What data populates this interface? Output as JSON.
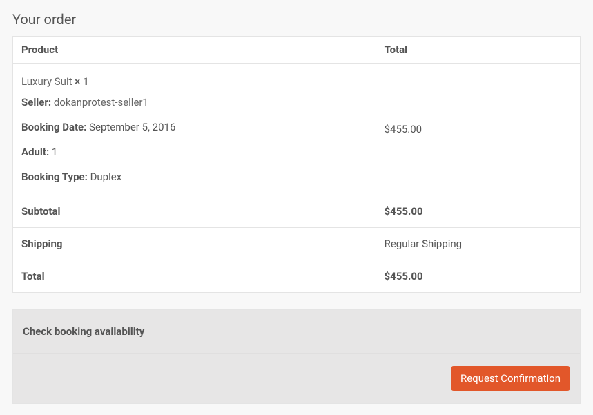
{
  "section_title": "Your order",
  "table": {
    "header_product": "Product",
    "header_total": "Total"
  },
  "product": {
    "name": "Luxury Suit",
    "qty_prefix": "  × ",
    "qty": "1",
    "seller_label": "Seller:",
    "seller_value": " dokanprotest-seller1",
    "booking_date_label": "Booking Date:",
    "booking_date_value": " September 5, 2016",
    "adult_label": "Adult:",
    "adult_value": " 1",
    "booking_type_label": "Booking Type:",
    "booking_type_value": " Duplex",
    "line_total": "$455.00"
  },
  "summary": {
    "subtotal_label": "Subtotal",
    "subtotal_value": "$455.00",
    "shipping_label": "Shipping",
    "shipping_value": "Regular Shipping",
    "total_label": "Total",
    "total_value": "$455.00"
  },
  "availability": {
    "title": "Check booking availability",
    "button": "Request Confirmation"
  }
}
